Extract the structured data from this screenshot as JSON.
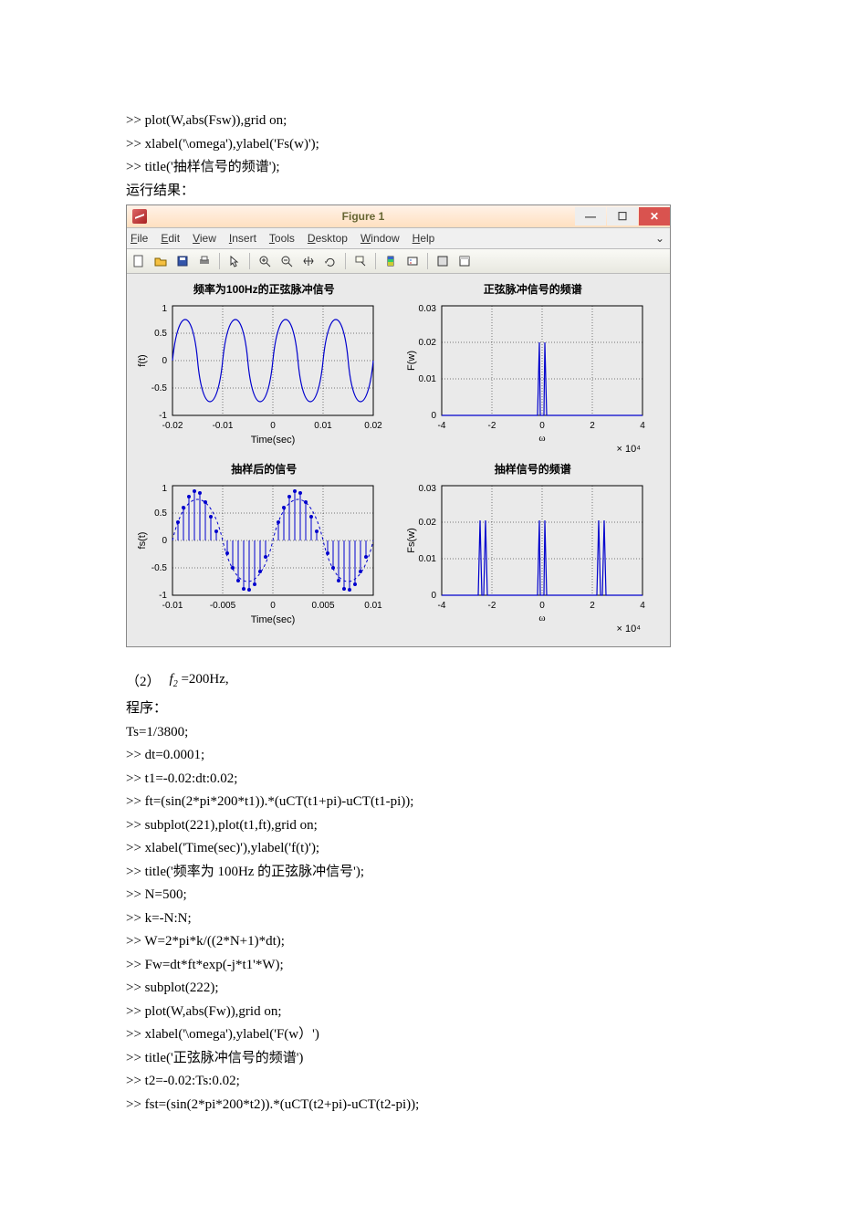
{
  "code_top": [
    ">> plot(W,abs(Fsw)),grid on;",
    ">> xlabel('\\omega'),ylabel('Fs(w)');",
    ">> title('抽样信号的频谱');"
  ],
  "run_result_label": "运行结果：",
  "figwin": {
    "title": "Figure 1",
    "menus": [
      "File",
      "Edit",
      "View",
      "Insert",
      "Tools",
      "Desktop",
      "Window",
      "Help"
    ]
  },
  "subplots": {
    "tl": {
      "title": "频率为100Hz的正弦脉冲信号",
      "xlabel": "Time(sec)",
      "ylabel": "f(t)",
      "xticks": [
        "-0.02",
        "-0.01",
        "0",
        "0.01",
        "0.02"
      ],
      "yticks": [
        "-1",
        "-0.5",
        "0",
        "0.5",
        "1"
      ]
    },
    "tr": {
      "title": "正弦脉冲信号的频谱",
      "xlabel": "ω",
      "xsuffix": "× 10⁴",
      "ylabel": "F(w)",
      "xticks": [
        "-4",
        "-2",
        "0",
        "2",
        "4"
      ],
      "yticks": [
        "0",
        "0.01",
        "0.02",
        "0.03"
      ]
    },
    "bl": {
      "title": "抽样后的信号",
      "xlabel": "Time(sec)",
      "ylabel": "fs(t)",
      "xticks": [
        "-0.01",
        "-0.005",
        "0",
        "0.005",
        "0.01"
      ],
      "yticks": [
        "-1",
        "-0.5",
        "0",
        "0.5",
        "1"
      ]
    },
    "br": {
      "title": "抽样信号的频谱",
      "xlabel": "ω",
      "xsuffix": "× 10⁴",
      "ylabel": "Fs(w)",
      "xticks": [
        "-4",
        "-2",
        "0",
        "2",
        "4"
      ],
      "yticks": [
        "0",
        "0.01",
        "0.02",
        "0.03"
      ]
    }
  },
  "formula": {
    "index": "（2）",
    "text": "f₂ = 200Hz,",
    "var": "f",
    "sub": "2",
    "eq": " =200Hz,"
  },
  "program_label": "程序：",
  "code_bottom": [
    "Ts=1/3800;",
    ">> dt=0.0001;",
    ">> t1=-0.02:dt:0.02;",
    ">> ft=(sin(2*pi*200*t1)).*(uCT(t1+pi)-uCT(t1-pi));",
    ">> subplot(221),plot(t1,ft),grid on;",
    ">> xlabel('Time(sec)'),ylabel('f(t)');",
    ">> title('频率为 100Hz 的正弦脉冲信号');",
    ">> N=500;",
    ">> k=-N:N;",
    ">> W=2*pi*k/((2*N+1)*dt);",
    ">> Fw=dt*ft*exp(-j*t1'*W);",
    ">> subplot(222);",
    ">> plot(W,abs(Fw)),grid on;",
    ">> xlabel('\\omega'),ylabel('F(w）')",
    ">> title('正弦脉冲信号的频谱')",
    ">> t2=-0.02:Ts:0.02;",
    ">> fst=(sin(2*pi*200*t2)).*(uCT(t2+pi)-uCT(t2-pi));"
  ],
  "chart_data": [
    {
      "type": "line",
      "title": "频率为100Hz的正弦脉冲信号",
      "xlabel": "Time(sec)",
      "ylabel": "f(t)",
      "xlim": [
        -0.02,
        0.02
      ],
      "ylim": [
        -1,
        1
      ],
      "grid": true,
      "series": [
        {
          "name": "f(t)",
          "note": "sin(2π·100·t), continuous",
          "x_range": [
            -0.02,
            0.02
          ],
          "function": "sin(2*pi*100*t)"
        }
      ]
    },
    {
      "type": "line",
      "title": "正弦脉冲信号的频谱",
      "xlabel": "ω",
      "ylabel": "F(w)",
      "xlim": [
        -40000,
        40000
      ],
      "ylim": [
        0,
        0.03
      ],
      "grid": true,
      "x_scale_factor": 10000,
      "peaks": [
        {
          "omega": -628,
          "magnitude": 0.02
        },
        {
          "omega": 628,
          "magnitude": 0.02
        }
      ]
    },
    {
      "type": "line",
      "title": "抽样后的信号",
      "xlabel": "Time(sec)",
      "ylabel": "fs(t)",
      "xlim": [
        -0.01,
        0.01
      ],
      "ylim": [
        -1,
        1
      ],
      "grid": true,
      "series": [
        {
          "name": "envelope",
          "style": "dashed",
          "function": "sin(2*pi*100*t)"
        },
        {
          "name": "sampled",
          "style": "stems",
          "note": "impulse train at Ts≈1/3800"
        }
      ]
    },
    {
      "type": "line",
      "title": "抽样信号的频谱",
      "xlabel": "ω",
      "ylabel": "Fs(w)",
      "xlim": [
        -40000,
        40000
      ],
      "ylim": [
        0,
        0.03
      ],
      "grid": true,
      "x_scale_factor": 10000,
      "peaks": [
        {
          "omega": -24500,
          "magnitude": 0.02
        },
        {
          "omega": -23250,
          "magnitude": 0.02
        },
        {
          "omega": -628,
          "magnitude": 0.02
        },
        {
          "omega": 628,
          "magnitude": 0.02
        },
        {
          "omega": 23250,
          "magnitude": 0.02
        },
        {
          "omega": 24500,
          "magnitude": 0.02
        }
      ]
    }
  ]
}
